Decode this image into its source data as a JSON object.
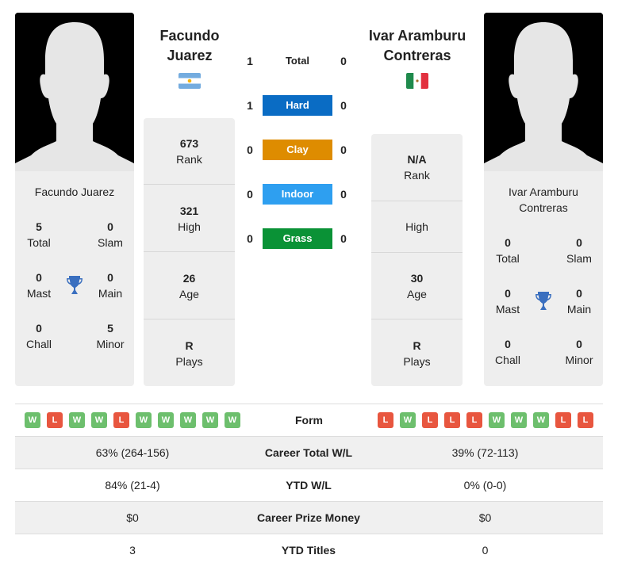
{
  "player1": {
    "name": "Facundo Juarez",
    "header_name_line1": "Facundo",
    "header_name_line2": "Juarez",
    "country": "Argentina",
    "flag_icon": "flag-argentina-icon",
    "titles": {
      "total": {
        "value": "5",
        "label": "Total"
      },
      "slam": {
        "value": "0",
        "label": "Slam"
      },
      "mast": {
        "value": "0",
        "label": "Mast"
      },
      "main": {
        "value": "0",
        "label": "Main"
      },
      "chall": {
        "value": "0",
        "label": "Chall"
      },
      "minor": {
        "value": "5",
        "label": "Minor"
      }
    },
    "stats": {
      "rank": {
        "value": "673",
        "label": "Rank"
      },
      "high": {
        "value": "321",
        "label": "High"
      },
      "age": {
        "value": "26",
        "label": "Age"
      },
      "plays": {
        "value": "R",
        "label": "Plays"
      }
    },
    "form": [
      "W",
      "L",
      "W",
      "W",
      "L",
      "W",
      "W",
      "W",
      "W",
      "W"
    ]
  },
  "player2": {
    "name_line1": "Ivar Aramburu",
    "name_line2": "Contreras",
    "header_name_line1": "Ivar Aramburu",
    "header_name_line2": "Contreras",
    "country": "Mexico",
    "flag_icon": "flag-mexico-icon",
    "titles": {
      "total": {
        "value": "0",
        "label": "Total"
      },
      "slam": {
        "value": "0",
        "label": "Slam"
      },
      "mast": {
        "value": "0",
        "label": "Mast"
      },
      "main": {
        "value": "0",
        "label": "Main"
      },
      "chall": {
        "value": "0",
        "label": "Chall"
      },
      "minor": {
        "value": "0",
        "label": "Minor"
      }
    },
    "stats": {
      "rank": {
        "value": "N/A",
        "label": "Rank"
      },
      "high": {
        "value": "",
        "label": "High"
      },
      "age": {
        "value": "30",
        "label": "Age"
      },
      "plays": {
        "value": "R",
        "label": "Plays"
      }
    },
    "form": [
      "L",
      "W",
      "L",
      "L",
      "L",
      "W",
      "W",
      "W",
      "L",
      "L"
    ]
  },
  "h2h": {
    "total": {
      "label": "Total",
      "p1": "1",
      "p2": "0"
    },
    "surfaces": [
      {
        "label": "Hard",
        "p1": "1",
        "p2": "0",
        "color": "#0a6cc4"
      },
      {
        "label": "Clay",
        "p1": "0",
        "p2": "0",
        "color": "#de8c00"
      },
      {
        "label": "Indoor",
        "p1": "0",
        "p2": "0",
        "color": "#2e9ff0"
      },
      {
        "label": "Grass",
        "p1": "0",
        "p2": "0",
        "color": "#0a9236"
      }
    ]
  },
  "comparison": {
    "form_label": "Form",
    "rows": [
      {
        "label": "Career Total W/L",
        "p1": "63% (264-156)",
        "p2": "39% (72-113)"
      },
      {
        "label": "YTD W/L",
        "p1": "84% (21-4)",
        "p2": "0% (0-0)"
      },
      {
        "label": "Career Prize Money",
        "p1": "$0",
        "p2": "$0"
      },
      {
        "label": "YTD Titles",
        "p1": "3",
        "p2": "0"
      }
    ]
  },
  "colors": {
    "win": "#6dbf6d",
    "loss": "#e8563f",
    "trophy": "#3a6fbf"
  }
}
